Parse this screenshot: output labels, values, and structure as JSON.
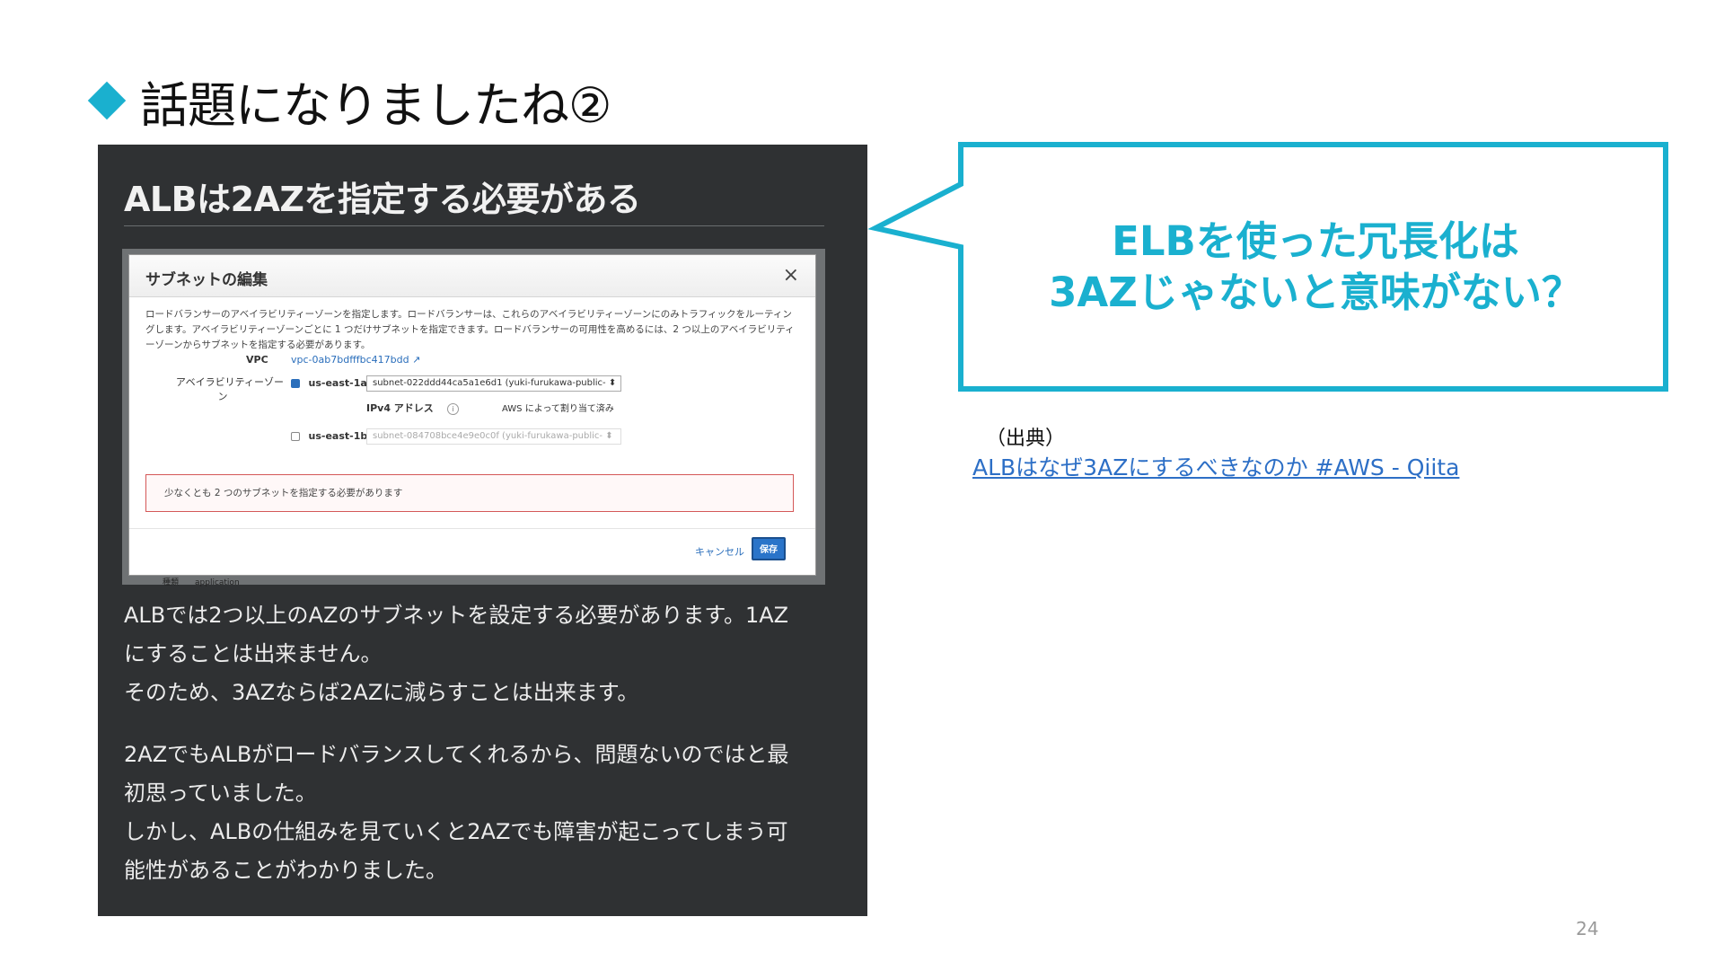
{
  "slide": {
    "title": "話題になりましたね②",
    "page_number": "24"
  },
  "panel": {
    "heading": "ALBは2AZを指定する必要がある",
    "paragraph1": [
      "ALBでは2つ以上のAZのサブネットを設定する必要があります。1AZ",
      "にすることは出来ません。",
      "そのため、3AZならば2AZに減らすことは出来ます。"
    ],
    "paragraph2": [
      "2AZでもALBがロードバランスしてくれるから、問題ないのではと最",
      "初思っていました。",
      "しかし、ALBの仕組みを見ていくと2AZでも障害が起こってしまう可",
      "能性があることがわかりました。"
    ]
  },
  "dialog": {
    "title": "サブネットの編集",
    "close_glyph": "×",
    "description": "ロードバランサーのアベイラビリティーゾーンを指定します。ロードバランサーは、これらのアベイラビリティーゾーンにのみトラフィックをルーティングします。アベイラビリティーゾーンごとに 1 つだけサブネットを指定できます。ロードバランサーの可用性を高めるには、2 つ以上のアベイラビリティーゾーンからサブネットを指定する必要があります。",
    "vpc_label": "VPC",
    "vpc_value": "vpc-0ab7bdfffbc417bdd",
    "external_glyph": "↗",
    "az_label_line1": "アベイラビリティーゾー",
    "az_label_line2": "ン",
    "az1": {
      "name": "us-east-1a",
      "checked": true,
      "subnet": "subnet-022ddd44ca5a1e6d1 (yuki-furukawa-public-",
      "select_arrow": "⬍"
    },
    "ipv4_label": "IPv4 アドレス",
    "ipv4_info": "i",
    "ipv4_value": "AWS によって割り当て済み",
    "az2": {
      "name": "us-east-1b",
      "checked": false,
      "subnet": "subnet-084708bce4e9e0c0f (yuki-furukawa-public-",
      "select_arrow": "⬍"
    },
    "error_message": "少なくとも 2 つのサブネットを指定する必要があります",
    "cancel_label": "キャンセル",
    "save_label": "保存",
    "underlay_text": "種類　　application"
  },
  "callout": {
    "line1": "ELBを使った冗長化は",
    "line2": "3AZじゃないと意味がない？",
    "color": "#1ab0cf"
  },
  "source": {
    "label": "（出典）",
    "link_text": "ALBはなぜ3AZにするべきなのか #AWS - Qiita"
  }
}
